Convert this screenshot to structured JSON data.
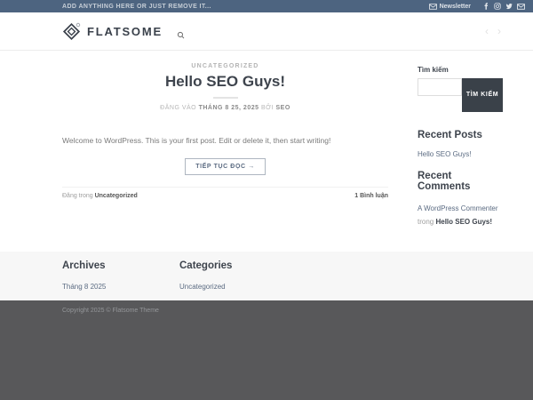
{
  "topbar": {
    "announcement": "ADD ANYTHING HERE OR JUST REMOVE IT...",
    "newsletter": "Newsletter",
    "social_icons": [
      "envelope",
      "facebook",
      "instagram",
      "twitter",
      "email"
    ]
  },
  "header": {
    "logo": "FLATSOME",
    "icons": [
      "search",
      "prev-arrow",
      "next-arrow"
    ],
    "prev_arrow": "‹",
    "next_arrow": "›"
  },
  "post": {
    "category_label": "UNCATEGORIZED",
    "title": "Hello SEO Guys!",
    "meta": {
      "posted_on": "ĐĂNG VÀO ",
      "date": "THÁNG 8 25, 2025",
      "by": " BỞI ",
      "author": "SEO"
    },
    "excerpt": "Welcome to WordPress. This is your first post. Edit or delete it, then start writing!",
    "read_more": "TIẾP TỤC ĐỌC →",
    "entry_footer": {
      "posted_in": "Đăng trong ",
      "category": "Uncategorized",
      "comments": "1 Bình luận"
    }
  },
  "sidebar": {
    "search": {
      "title": "Tìm kiếm",
      "value": "",
      "button": "TÌM KIẾM"
    },
    "recent_posts": {
      "title": "Recent Posts",
      "items": [
        "Hello SEO Guys!"
      ]
    },
    "recent_comments": {
      "title": "Recent Comments",
      "author": "A WordPress Commenter",
      "in_label": "trong ",
      "post": "Hello SEO Guys!"
    }
  },
  "footer": {
    "archives": {
      "title": "Archives",
      "items": [
        "Tháng 8 2025"
      ]
    },
    "categories": {
      "title": "Categories",
      "items": [
        "Uncategorized"
      ]
    },
    "copyright": "Copyright 2025 © Flatsome Theme"
  },
  "colors": {
    "topbar_bg": "#4d6480",
    "search_button_bg": "#3a4149",
    "heading": "#3e444d",
    "link": "#5b6b82",
    "footer_bg": "#f7f7f7",
    "copyright_bg": "#58585a"
  }
}
